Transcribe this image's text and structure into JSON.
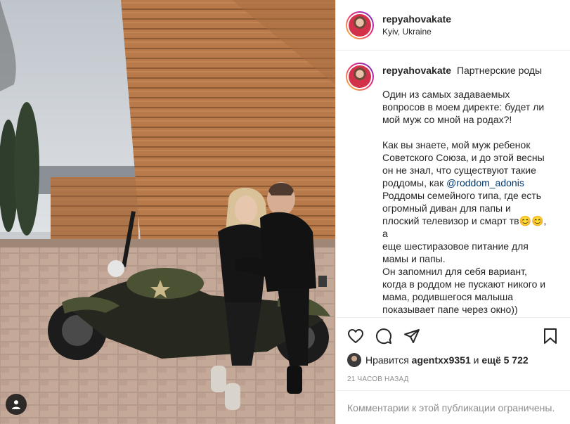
{
  "post": {
    "author": "repyahovakate",
    "location": "Kyiv, Ukraine",
    "caption_title": "Партнерские роды",
    "caption_paragraphs": [
      [
        "Один из самых задаваемых",
        "вопросов в моем директе: будет ли",
        "мой муж со мной на родах?!"
      ],
      [
        "Как вы знаете, мой муж ребенок",
        "Советского Союза, и до этой весны",
        "он не знал, что существуют такие"
      ]
    ],
    "caption_mention_prefix": "роддомы, как ",
    "caption_mention": "@roddom_adonis",
    "caption_tail_lines": [
      "Роддомы семейного типа, где есть",
      "огромный диван для папы и",
      "плоский телевизор и смарт тв😊😊, а",
      "еще шестиразовое питание для",
      "мамы и папы.",
      "Он запомнил для себя вариант,",
      "когда в роддом не пускают никого и",
      "мама, родившегося малыша",
      "показывает папе через окно))"
    ],
    "likes_prefix": "Нравится",
    "liked_by": "agentxx9351",
    "likes_middle": "и",
    "likes_more": "ещё 5 722",
    "timestamp": "21 ЧАСОВ НАЗАД",
    "comments_notice": "Комментарии к этой публикации ограничены."
  },
  "icons": {
    "like": "heart-icon",
    "comment": "comment-icon",
    "share": "share-icon",
    "save": "bookmark-icon",
    "user_tags": "user-tag-icon"
  },
  "colors": {
    "text": "#262626",
    "muted": "#8e8e8e",
    "link": "#00376b",
    "divider": "#efefef"
  }
}
